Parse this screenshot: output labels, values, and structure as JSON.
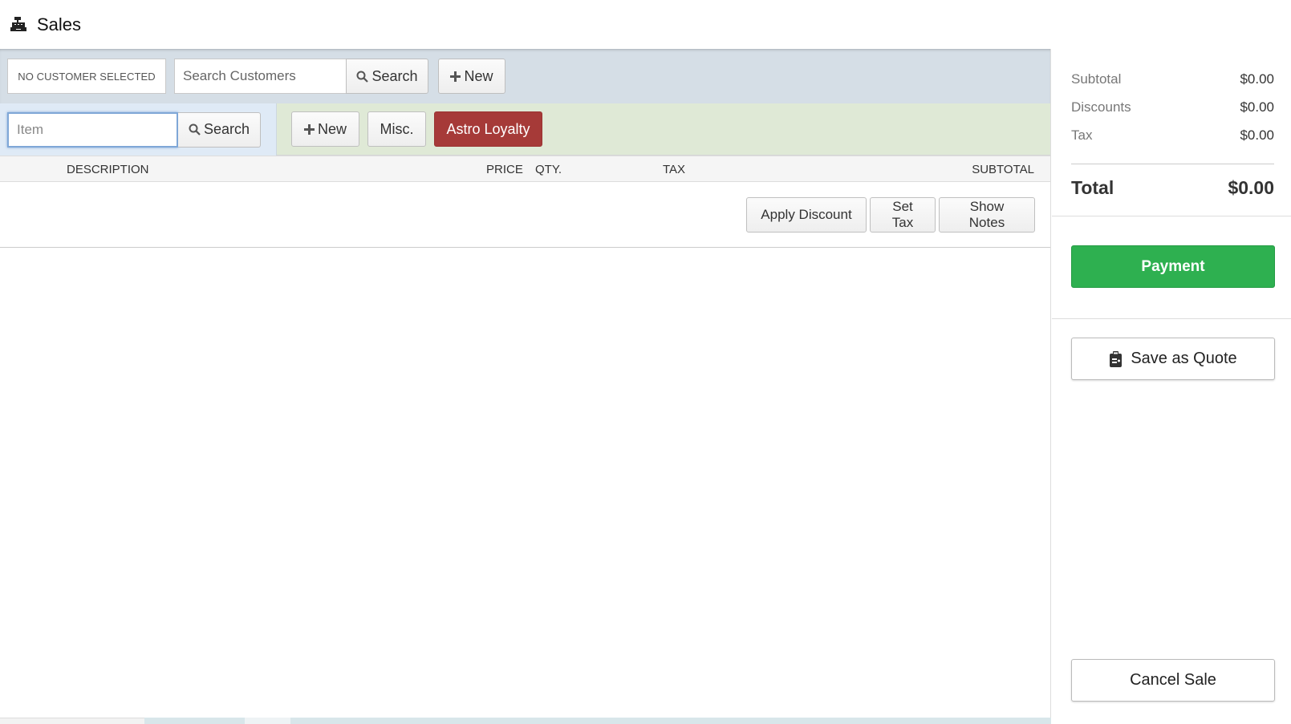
{
  "header": {
    "title": "Sales",
    "icon": "cash-register-icon"
  },
  "customer": {
    "status_label": "NO CUSTOMER SELECTED",
    "search_placeholder": "Search Customers",
    "search_button": "Search",
    "new_button": "New"
  },
  "item": {
    "input_placeholder": "Item",
    "search_button": "Search",
    "new_button": "New",
    "misc_button": "Misc.",
    "loyalty_button": "Astro Loyalty"
  },
  "table": {
    "columns": [
      "DESCRIPTION",
      "PRICE",
      "QTY.",
      "TAX",
      "SUBTOTAL"
    ]
  },
  "actions": {
    "apply_discount": "Apply Discount",
    "set_tax": "Set Tax",
    "show_notes": "Show Notes"
  },
  "summary": {
    "subtotal_label": "Subtotal",
    "subtotal_value": "$0.00",
    "discounts_label": "Discounts",
    "discounts_value": "$0.00",
    "tax_label": "Tax",
    "tax_value": "$0.00",
    "total_label": "Total",
    "total_value": "$0.00"
  },
  "buttons": {
    "payment": "Payment",
    "save_quote": "Save as Quote",
    "cancel_sale": "Cancel Sale"
  },
  "colors": {
    "customer_bar": "#d5dee6",
    "item_bar_left": "#dfeaf6",
    "item_bar_right": "#dfe9d6",
    "loyalty": "#a63a38",
    "payment": "#2eb050"
  }
}
